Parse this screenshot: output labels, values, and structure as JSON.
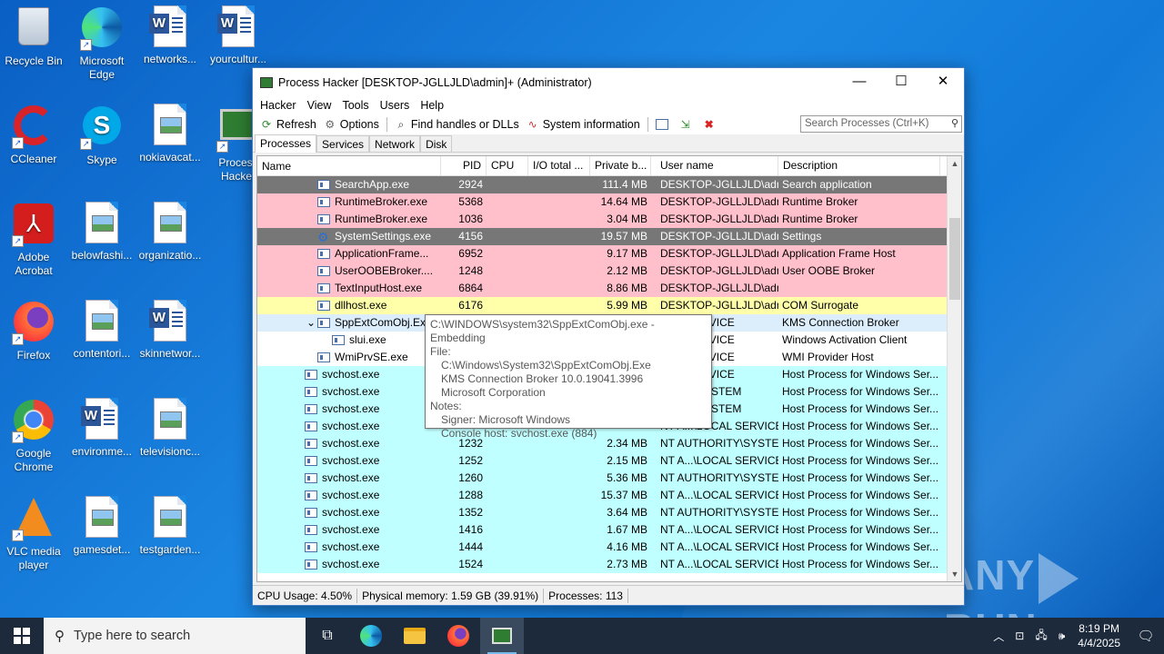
{
  "desktop": {
    "icons": [
      {
        "label": "Recycle Bin",
        "kind": "recycle"
      },
      {
        "label": "Microsoft Edge",
        "kind": "edge"
      },
      {
        "label": "networks...",
        "kind": "word"
      },
      {
        "label": "yourcultur...",
        "kind": "word"
      },
      {
        "label": "CCleaner",
        "kind": "ccleaner"
      },
      {
        "label": "Skype",
        "kind": "skype"
      },
      {
        "label": "nokiavacat...",
        "kind": "image"
      },
      {
        "label": "Process Hacker",
        "kind": "prochacker"
      },
      {
        "label": "Adobe Acrobat",
        "kind": "acrobat"
      },
      {
        "label": "belowfashi...",
        "kind": "image"
      },
      {
        "label": "organizatio...",
        "kind": "image"
      },
      {
        "label": "Firefox",
        "kind": "firefox"
      },
      {
        "label": "contentori...",
        "kind": "image"
      },
      {
        "label": "skinnetwor...",
        "kind": "word"
      },
      {
        "label": "Google Chrome",
        "kind": "chrome"
      },
      {
        "label": "environme...",
        "kind": "word"
      },
      {
        "label": "televisionc...",
        "kind": "image"
      },
      {
        "label": "VLC media player",
        "kind": "vlc"
      },
      {
        "label": "gamesdet...",
        "kind": "image"
      },
      {
        "label": "testgarden...",
        "kind": "image"
      }
    ]
  },
  "window": {
    "title": "Process Hacker [DESKTOP-JGLLJLD\\admin]+ (Administrator)",
    "controls": {
      "minimize": "—",
      "maximize": "☐",
      "close": "✕"
    },
    "menu": [
      "Hacker",
      "View",
      "Tools",
      "Users",
      "Help"
    ],
    "toolbar": {
      "refresh": "Refresh",
      "options": "Options",
      "find_handles": "Find handles or DLLs",
      "sysinfo": "System information",
      "search_placeholder": "Search Processes (Ctrl+K)"
    },
    "tabs": [
      "Processes",
      "Services",
      "Network",
      "Disk"
    ],
    "columns": [
      "Name",
      "PID",
      "CPU",
      "I/O total ...",
      "Private b...",
      "User name",
      "Description"
    ],
    "rows": [
      {
        "name": "SearchApp.exe",
        "pid": "2924",
        "cpu": "",
        "io": "",
        "priv": "111.4 MB",
        "user": "DESKTOP-JGLLJLD\\admi",
        "desc": "Search application",
        "color": "gray",
        "indent": 1
      },
      {
        "name": "RuntimeBroker.exe",
        "pid": "5368",
        "cpu": "",
        "io": "",
        "priv": "14.64 MB",
        "user": "DESKTOP-JGLLJLD\\admi",
        "desc": "Runtime Broker",
        "color": "pink",
        "indent": 1
      },
      {
        "name": "RuntimeBroker.exe",
        "pid": "1036",
        "cpu": "",
        "io": "",
        "priv": "3.04 MB",
        "user": "DESKTOP-JGLLJLD\\admi",
        "desc": "Runtime Broker",
        "color": "pink",
        "indent": 1
      },
      {
        "name": "SystemSettings.exe",
        "pid": "4156",
        "cpu": "",
        "io": "",
        "priv": "19.57 MB",
        "user": "DESKTOP-JGLLJLD\\admi",
        "desc": "Settings",
        "color": "gray",
        "indent": 1
      },
      {
        "name": "ApplicationFrame...",
        "pid": "6952",
        "cpu": "",
        "io": "",
        "priv": "9.17 MB",
        "user": "DESKTOP-JGLLJLD\\admi",
        "desc": "Application Frame Host",
        "color": "pink",
        "indent": 1
      },
      {
        "name": "UserOOBEBroker....",
        "pid": "1248",
        "cpu": "",
        "io": "",
        "priv": "2.12 MB",
        "user": "DESKTOP-JGLLJLD\\admi",
        "desc": "User OOBE Broker",
        "color": "pink",
        "indent": 1
      },
      {
        "name": "TextInputHost.exe",
        "pid": "6864",
        "cpu": "",
        "io": "",
        "priv": "8.86 MB",
        "user": "DESKTOP-JGLLJLD\\admi",
        "desc": "",
        "color": "pink",
        "indent": 1
      },
      {
        "name": "dllhost.exe",
        "pid": "6176",
        "cpu": "",
        "io": "",
        "priv": "5.99 MB",
        "user": "DESKTOP-JGLLJLD\\admi",
        "desc": "COM Surrogate",
        "color": "yellow",
        "indent": 1
      },
      {
        "name": "SppExtComObj.Exe",
        "pid": "",
        "cpu": "",
        "io": "",
        "priv": "",
        "user": "ORK SERVICE",
        "desc": "KMS Connection Broker",
        "color": "lblue",
        "indent": 1,
        "expanded": true
      },
      {
        "name": "slui.exe",
        "pid": "",
        "cpu": "",
        "io": "",
        "priv": "",
        "user": "ORK SERVICE",
        "desc": "Windows Activation Client",
        "color": "white",
        "indent": 2
      },
      {
        "name": "WmiPrvSE.exe",
        "pid": "",
        "cpu": "",
        "io": "",
        "priv": "",
        "user": "ORK SERVICE",
        "desc": "WMI Provider Host",
        "color": "white",
        "indent": 1
      },
      {
        "name": "svchost.exe",
        "pid": "",
        "cpu": "",
        "io": "",
        "priv": "",
        "user": "ORK SERVICE",
        "desc": "Host Process for Windows Ser...",
        "color": "cyan",
        "indent": 0
      },
      {
        "name": "svchost.exe",
        "pid": "",
        "cpu": "",
        "io": "",
        "priv": "",
        "user": "ORITY\\SYSTEM",
        "desc": "Host Process for Windows Ser...",
        "color": "cyan",
        "indent": 0
      },
      {
        "name": "svchost.exe",
        "pid": "",
        "cpu": "",
        "io": "",
        "priv": "",
        "user": "ORITY\\SYSTEM",
        "desc": "Host Process for Windows Ser...",
        "color": "cyan",
        "indent": 0
      },
      {
        "name": "svchost.exe",
        "pid": "",
        "cpu": "",
        "io": "",
        "priv": "",
        "user": "NT A...\\LOCAL SERVICE",
        "desc": "Host Process for Windows Ser...",
        "color": "cyan",
        "indent": 0
      },
      {
        "name": "svchost.exe",
        "pid": "1232",
        "cpu": "",
        "io": "",
        "priv": "2.34 MB",
        "user": "NT AUTHORITY\\SYSTEM",
        "desc": "Host Process for Windows Ser...",
        "color": "cyan",
        "indent": 0
      },
      {
        "name": "svchost.exe",
        "pid": "1252",
        "cpu": "",
        "io": "",
        "priv": "2.15 MB",
        "user": "NT A...\\LOCAL SERVICE",
        "desc": "Host Process for Windows Ser...",
        "color": "cyan",
        "indent": 0
      },
      {
        "name": "svchost.exe",
        "pid": "1260",
        "cpu": "",
        "io": "",
        "priv": "5.36 MB",
        "user": "NT AUTHORITY\\SYSTEM",
        "desc": "Host Process for Windows Ser...",
        "color": "cyan",
        "indent": 0
      },
      {
        "name": "svchost.exe",
        "pid": "1288",
        "cpu": "",
        "io": "",
        "priv": "15.37 MB",
        "user": "NT A...\\LOCAL SERVICE",
        "desc": "Host Process for Windows Ser...",
        "color": "cyan",
        "indent": 0
      },
      {
        "name": "svchost.exe",
        "pid": "1352",
        "cpu": "",
        "io": "",
        "priv": "3.64 MB",
        "user": "NT AUTHORITY\\SYSTEM",
        "desc": "Host Process for Windows Ser...",
        "color": "cyan",
        "indent": 0
      },
      {
        "name": "svchost.exe",
        "pid": "1416",
        "cpu": "",
        "io": "",
        "priv": "1.67 MB",
        "user": "NT A...\\LOCAL SERVICE",
        "desc": "Host Process for Windows Ser...",
        "color": "cyan",
        "indent": 0
      },
      {
        "name": "svchost.exe",
        "pid": "1444",
        "cpu": "",
        "io": "",
        "priv": "4.16 MB",
        "user": "NT A...\\LOCAL SERVICE",
        "desc": "Host Process for Windows Ser...",
        "color": "cyan",
        "indent": 0
      },
      {
        "name": "svchost.exe",
        "pid": "1524",
        "cpu": "",
        "io": "",
        "priv": "2.73 MB",
        "user": "NT A...\\LOCAL SERVICE",
        "desc": "Host Process for Windows Ser...",
        "color": "cyan",
        "indent": 0
      }
    ],
    "tooltip": {
      "lines": [
        {
          "text": "C:\\WINDOWS\\system32\\SppExtComObj.exe -Embedding",
          "indent": false
        },
        {
          "text": "File:",
          "indent": false
        },
        {
          "text": "C:\\Windows\\System32\\SppExtComObj.Exe",
          "indent": true
        },
        {
          "text": "KMS Connection Broker 10.0.19041.3996",
          "indent": true
        },
        {
          "text": "Microsoft Corporation",
          "indent": true
        },
        {
          "text": "Notes:",
          "indent": false
        },
        {
          "text": "Signer: Microsoft Windows",
          "indent": true
        },
        {
          "text": "Console host: svchost.exe (884)",
          "indent": true
        }
      ]
    },
    "status": {
      "cpu": "CPU Usage: 4.50%",
      "mem": "Physical memory: 1.59 GB (39.91%)",
      "procs": "Processes: 113"
    }
  },
  "watermark": {
    "left": "ANY",
    "right": "RUN"
  },
  "taskbar": {
    "search_placeholder": "Type here to search",
    "time": "8:19 PM",
    "date": "4/4/2025"
  },
  "colors": {
    "gray": "#777777",
    "pink": "#ffc0cb",
    "yellow": "#ffffaa",
    "lblue": "#dceefc",
    "cyan": "#c0ffff",
    "accent": "#1b86e2"
  }
}
